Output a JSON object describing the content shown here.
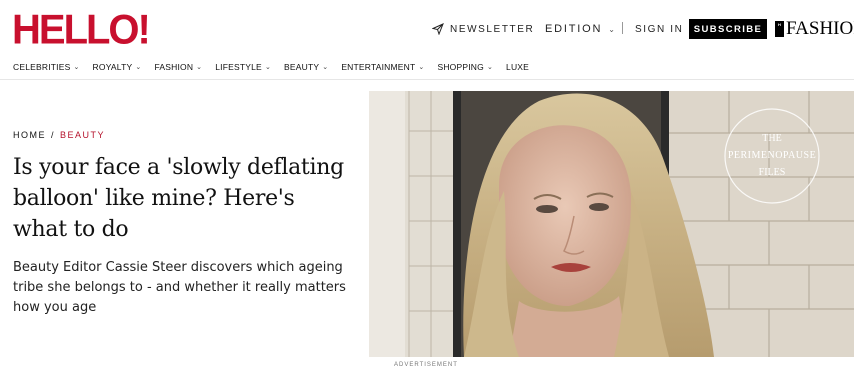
{
  "header": {
    "logo": "HELLO!",
    "newsletter": "NEWSLETTER",
    "edition": "EDITION",
    "sign_in": "SIGN IN",
    "subscribe": "SUBSCRIBE",
    "fashion_brand": "FASHION",
    "fashion_badge": "HELLO!",
    "brand_color": "#c8102e"
  },
  "nav": {
    "items": [
      {
        "label": "CELEBRITIES",
        "dropdown": true
      },
      {
        "label": "ROYALTY",
        "dropdown": true
      },
      {
        "label": "FASHION",
        "dropdown": true
      },
      {
        "label": "LIFESTYLE",
        "dropdown": true
      },
      {
        "label": "BEAUTY",
        "dropdown": true
      },
      {
        "label": "ENTERTAINMENT",
        "dropdown": true
      },
      {
        "label": "SHOPPING",
        "dropdown": true
      },
      {
        "label": "LUXE",
        "dropdown": false
      }
    ]
  },
  "breadcrumb": {
    "home": "HOME",
    "separator": "/",
    "category": "BEAUTY",
    "category_color": "#b5122b"
  },
  "article": {
    "title": "Is your face a 'slowly deflating balloon' like mine? Here's what to do",
    "standfirst": "Beauty Editor Cassie Steer discovers which ageing tribe she belongs to - and whether it really matters how you age"
  },
  "hero": {
    "watermark_line1": "THE",
    "watermark_line2": "PERIMENOPAUSE",
    "watermark_line3": "FILES"
  },
  "ad_label": "ADVERTISEMENT"
}
